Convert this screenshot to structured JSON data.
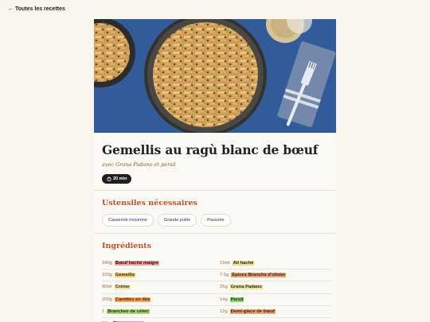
{
  "nav": {
    "back_arrow": "←",
    "back_label": "Toutes les recettes"
  },
  "recipe": {
    "title": "Gemellis au ragù blanc de bœuf",
    "subtitle": "avec Grana Padano et persil",
    "time_icon": "stopwatch-icon",
    "time": "20 min"
  },
  "utensils": {
    "heading": "Ustensiles nécessaires",
    "items": [
      "Casserole moyenne",
      "Grande poêle",
      "Passoire"
    ]
  },
  "ingredients": {
    "heading": "Ingrédients",
    "left": [
      {
        "qty": "340g",
        "name": "Bœuf haché maigre",
        "color": "#e9a0a0",
        "text_color": "#3a0b0b"
      },
      {
        "qty": "320g",
        "name": "Gemellis",
        "color": "#f2d27a",
        "text_color": "#3a2a00"
      },
      {
        "qty": "90ml",
        "name": "Crème",
        "color": "#f4e3b0",
        "text_color": "#3a2a00"
      },
      {
        "qty": "200g",
        "name": "Carottes en dés",
        "color": "#f3a95c",
        "text_color": "#5a1a00"
      },
      {
        "qty": "1",
        "name": "Branches de céleri",
        "color": "#a9d67c",
        "text_color": "#1e3a00"
      },
      {
        "qty": "56g",
        "name": "Oignon rouge",
        "color": "#d7a0cf",
        "text_color": "#3a0b34"
      }
    ],
    "right": [
      {
        "qty": "15ml",
        "name": "Ail haché",
        "color": "#e9e0a0",
        "text_color": "#2e2a00"
      },
      {
        "qty": "7.5g",
        "name": "Épices Branche d'olivier",
        "color": "#e6a77a",
        "text_color": "#4a1f00"
      },
      {
        "qty": "25g",
        "name": "Grana Padano",
        "color": "#efe1a8",
        "text_color": "#3a2a00"
      },
      {
        "qty": "14g",
        "name": "Persil",
        "color": "#8fd07a",
        "text_color": "#123a00"
      },
      {
        "qty": "12g",
        "name": "Demi-glace de bœuf",
        "color": "#e6a77a",
        "text_color": "#4a1f00"
      },
      {
        "qty": "",
        "name": "",
        "color": "#ffffff",
        "text_color": "#000000"
      }
    ]
  }
}
